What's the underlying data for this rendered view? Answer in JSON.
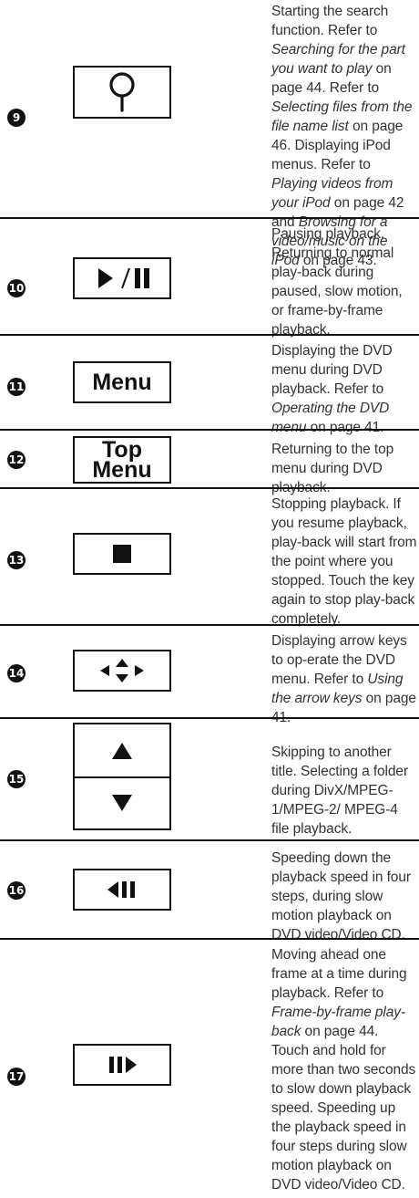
{
  "rows": [
    {
      "num": "9",
      "desc": [
        {
          "t": "Starting the search function. Refer to "
        },
        {
          "i": "Searching for the part you want to play"
        },
        {
          "t": " on page 44. Refer to "
        },
        {
          "i": "Selecting files from the file name list"
        },
        {
          "t": " on page 46. Displaying iPod menus. Refer to "
        },
        {
          "i": "Playing videos from your iPod"
        },
        {
          "t": " on page 42 and "
        },
        {
          "i": "Browsing for a video/music on the iPod"
        },
        {
          "t": " on page 43."
        }
      ]
    },
    {
      "num": "10",
      "desc": [
        {
          "t": "Pausing playback. Returning to normal play-back during paused, slow motion, or frame-by-frame playback."
        }
      ]
    },
    {
      "num": "11",
      "key_label": "Menu",
      "desc": [
        {
          "t": "Displaying the DVD menu during DVD playback. Refer to "
        },
        {
          "i": "Operating the DVD menu"
        },
        {
          "t": " on page 41."
        }
      ]
    },
    {
      "num": "12",
      "key_label_1": "Top",
      "key_label_2": "Menu",
      "desc": [
        {
          "t": "Returning to the top menu during DVD playback."
        }
      ]
    },
    {
      "num": "13",
      "desc": [
        {
          "t": "Stopping playback. If you resume playback, play-back will start from the point where you stopped. Touch the key again to stop play-back completely."
        }
      ]
    },
    {
      "num": "14",
      "desc": [
        {
          "t": "Displaying arrow keys to op-erate the DVD menu. Refer to "
        },
        {
          "i": "Using the arrow keys"
        },
        {
          "t": " on page 41."
        }
      ]
    },
    {
      "num": "15",
      "desc": [
        {
          "t": "Skipping to another title. Selecting a folder during DivX/MPEG-1/MPEG-2/ MPEG-4 file playback."
        }
      ]
    },
    {
      "num": "16",
      "desc": [
        {
          "t": "Speeding down the playback speed in four steps, during slow motion playback on DVD video/Video CD."
        }
      ]
    },
    {
      "num": "17",
      "desc": [
        {
          "t": "Moving ahead one frame at a time during playback. Refer to "
        },
        {
          "i": "Frame-by-frame play-back"
        },
        {
          "t": " on page 44. Touch and hold for more than two seconds to slow down playback speed. Speeding up the playback speed in four steps during slow motion playback on DVD video/Video CD."
        }
      ]
    }
  ]
}
